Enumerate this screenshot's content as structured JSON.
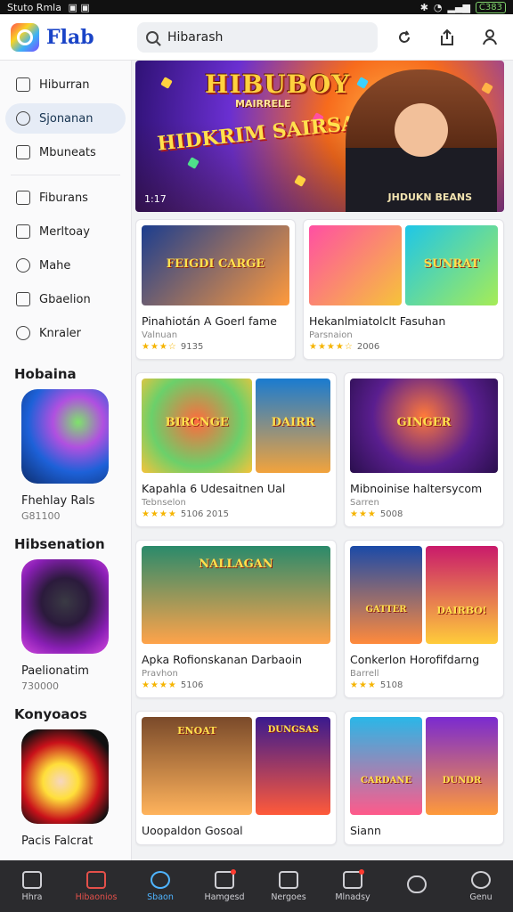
{
  "status_bar": {
    "left_text": "Stuto Rmla",
    "battery": "C383"
  },
  "app": {
    "name": "Flab"
  },
  "search": {
    "value": "Hibarash",
    "placeholder": "Hibarash"
  },
  "top_icons": [
    "refresh-icon",
    "share-icon",
    "profile-icon"
  ],
  "sidebar": {
    "primary": [
      {
        "label": "Hiburran",
        "icon": "grid-icon",
        "active": false
      },
      {
        "label": "Sjonanan",
        "icon": "games-icon",
        "active": true
      },
      {
        "label": "Mbuneats",
        "icon": "list-icon",
        "active": false
      }
    ],
    "secondary": [
      {
        "label": "Fiburans",
        "icon": "home-icon"
      },
      {
        "label": "Merltoay",
        "icon": "upload-icon"
      },
      {
        "label": "Mahe",
        "icon": "circle-icon"
      },
      {
        "label": "Gbaelion",
        "icon": "shield-icon"
      },
      {
        "label": "Knraler",
        "icon": "heart-icon"
      }
    ],
    "sections": [
      {
        "heading": "Hobaina",
        "title": "Fhehlay Rals",
        "sub": "G81100",
        "colors": [
          "#1d61d8",
          "#7ee36b"
        ]
      },
      {
        "heading": "Hibsenation",
        "title": "Paelionatim",
        "sub": "730000",
        "colors": [
          "#8a1fb5",
          "#2b1a3c"
        ]
      },
      {
        "heading": "Konyoaos",
        "title": "Pacis Falcrat",
        "sub": "",
        "colors": [
          "#c9111a",
          "#ffdf3a"
        ]
      }
    ]
  },
  "hero": {
    "title": "HIBUBOY",
    "subtitle": "MAIRRELE",
    "badge": "HIDKRIM SAIRSAN",
    "shirt": "JHDUKN BEANS",
    "count": "1:17"
  },
  "cards": [
    {
      "title": "Pinahiotán A Goerl fame",
      "sub": "Valnuan",
      "stars": "★★★☆",
      "rating": "9135",
      "images": [
        {
          "label": "FEIGDI CARGE",
          "c1": "#1b3d8f",
          "c2": "#ff9a3c"
        }
      ]
    },
    {
      "title": "Hekanlmiatolclt Fasuhan",
      "sub": "Parsnaion",
      "stars": "★★★★☆",
      "rating": "2006",
      "images": [
        {
          "label": "",
          "c1": "#ff4fa3",
          "c2": "#f6c33a"
        },
        {
          "label": "SUNRAT",
          "c1": "#1ec6e8",
          "c2": "#a6ec56"
        }
      ]
    },
    {
      "title": "Kapahla 6 Udesaitnen Ual",
      "sub": "Tebnselon",
      "stars": "★★★★",
      "rating": "5106 2015",
      "images": [
        {
          "label": "BIRCNGE",
          "c1": "#ff6a3d",
          "c2": "#6bd06a"
        },
        {
          "label": "DAIRR",
          "c1": "#1a7bd0",
          "c2": "#f2a33c"
        }
      ]
    },
    {
      "title": "Mibnoinise haltersycom",
      "sub": "Sarren",
      "stars": "★★★",
      "rating": "5008",
      "images": [
        {
          "label": "GINGER",
          "c1": "#5a1e8f",
          "c2": "#ff7a3a"
        }
      ]
    },
    {
      "title": "Apka Rofionskanan Darbaoin",
      "sub": "Pravhon",
      "stars": "★★★★",
      "rating": "5106",
      "images": [
        {
          "label": "NALLAGAN",
          "c1": "#2a8a6b",
          "c2": "#ffa34a"
        }
      ]
    },
    {
      "title": "Conkerlon Horofifdarng",
      "sub": "Barrell",
      "stars": "★★★",
      "rating": "5108",
      "images": [
        {
          "label": "GATTER",
          "c1": "#1b4aa8",
          "c2": "#ff8a3c"
        },
        {
          "label": "DAIRBO!",
          "c1": "#c91a6b",
          "c2": "#ffcc3a"
        }
      ]
    },
    {
      "title": "Uoopaldon Gosoal",
      "sub": "",
      "stars": "",
      "rating": "",
      "images": [
        {
          "label": "ENOAT",
          "c1": "#7a4a2a",
          "c2": "#ffb35c"
        },
        {
          "label": "DUNGSAS",
          "c1": "#3a1a8f",
          "c2": "#ff5a3a"
        }
      ]
    },
    {
      "title": "Siann",
      "sub": "",
      "stars": "",
      "rating": "",
      "images": [
        {
          "label": "CARDANE",
          "c1": "#2ab7e8",
          "c2": "#ff5a8a"
        },
        {
          "label": "DUNDR",
          "c1": "#7a2ad0",
          "c2": "#ff9a3a"
        }
      ]
    }
  ],
  "bottom_nav": [
    {
      "label": "Hhra",
      "icon": "home-icon",
      "state": "normal"
    },
    {
      "label": "Hibaonios",
      "icon": "heart-icon",
      "state": "red"
    },
    {
      "label": "Sbaon",
      "icon": "search-circle-icon",
      "state": "active"
    },
    {
      "label": "Hamgesd",
      "icon": "check-icon",
      "state": "dot"
    },
    {
      "label": "Nergoes",
      "icon": "apps-icon",
      "state": "normal"
    },
    {
      "label": "Mlnadsy",
      "icon": "chart-icon",
      "state": "dot"
    },
    {
      "label": "",
      "icon": "link-icon",
      "state": "normal"
    },
    {
      "label": "Genu",
      "icon": "account-icon",
      "state": "normal"
    }
  ]
}
